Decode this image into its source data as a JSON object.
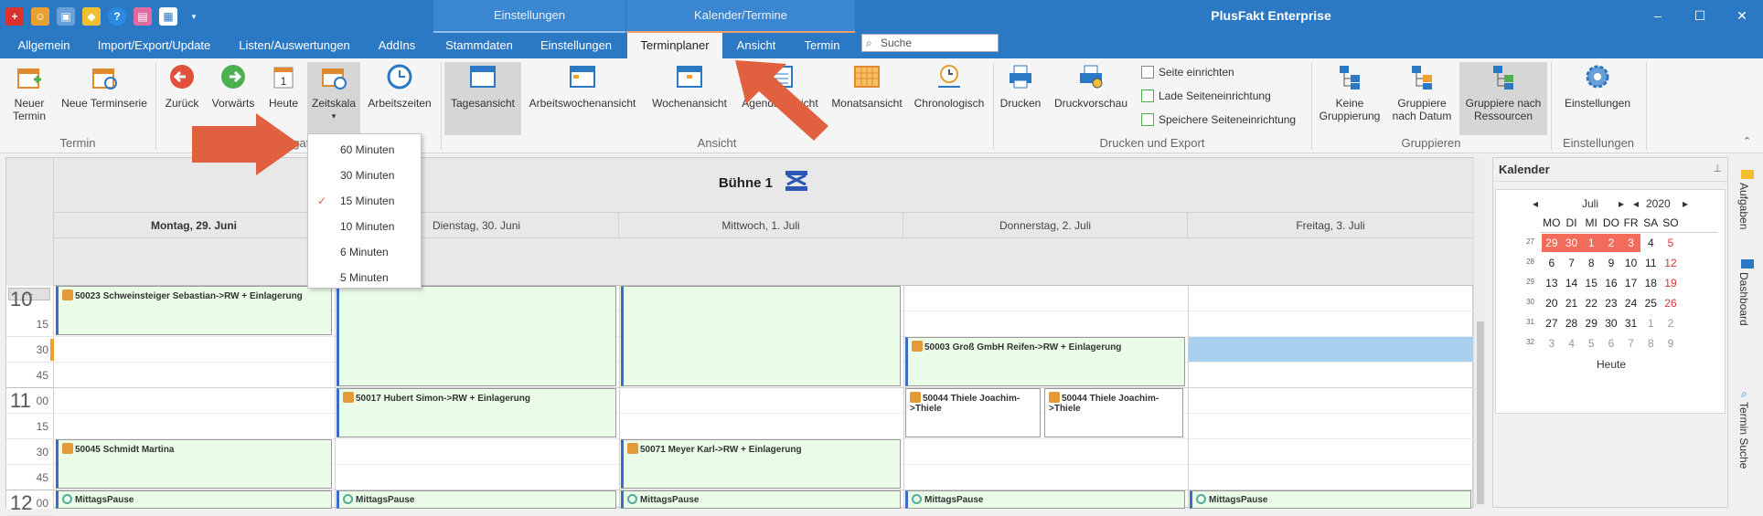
{
  "title_bar": {
    "context_tab_einstellungen": "Einstellungen",
    "context_tab_kalender": "Kalender/Termine",
    "app_title": "PlusFakt Enterprise",
    "minimize": "–",
    "maximize": "☐",
    "close": "✕"
  },
  "tabs": {
    "allgemein": "Allgemein",
    "import_export": "Import/Export/Update",
    "listen": "Listen/Auswertungen",
    "addins": "AddIns",
    "stammdaten": "Stammdaten",
    "einstellungen": "Einstellungen",
    "terminplaner": "Terminplaner",
    "ansicht": "Ansicht",
    "termin": "Termin"
  },
  "search": {
    "placeholder": "Suche"
  },
  "ribbon": {
    "neuer_termin": "Neuer Termin",
    "neue_terminserie": "Neue Terminserie",
    "zurueck": "Zurück",
    "vorwaerts": "Vorwärts",
    "heute": "Heute",
    "zeitskala": "Zeitskala",
    "arbeitszeiten": "Arbeitszeiten",
    "tagesansicht": "Tagesansicht",
    "arbeitswochenansicht": "Arbeitswochenansicht",
    "wochenansicht": "Wochenansicht",
    "agenda_ansicht": "Agenda Ansicht",
    "monatsansicht": "Monatsansicht",
    "chronologisch": "Chronologisch",
    "drucken": "Drucken",
    "druckvorschau": "Druckvorschau",
    "seite_einrichten": "Seite einrichten",
    "lade_seiteneinrichtung": "Lade Seiteneinrichtung",
    "speichere_seiteneinrichtung": "Speichere Seiteneinrichtung",
    "keine_gruppierung": "Keine Gruppierung",
    "gruppiere_datum": "Gruppiere nach Datum",
    "gruppiere_ressourcen": "Gruppiere nach Ressourcen",
    "einstellungen": "Einstellungen",
    "group_termin": "Termin",
    "group_navigation": "Navigation",
    "group_ansicht": "Ansicht",
    "group_drucken": "Drucken und Export",
    "group_gruppieren": "Gruppieren",
    "group_einstellungen": "Einstellungen",
    "heute_day": "1"
  },
  "zeitskala_menu": {
    "items": [
      "60 Minuten",
      "30 Minuten",
      "15 Minuten",
      "10 Minuten",
      "6 Minuten",
      "5 Minuten"
    ],
    "checked": "15 Minuten"
  },
  "calendar": {
    "resource": "Bühne 1",
    "days": [
      "Montag, 29. Juni",
      "Dienstag, 30. Juni",
      "Mittwoch, 1. Juli",
      "Donnerstag, 2. Juli",
      "Freitag, 3. Juli"
    ],
    "more": "···",
    "hour_10": "10",
    "hour_11": "11",
    "hour_12": "12",
    "slot_15": "15",
    "slot_30": "30",
    "slot_45": "45",
    "slot_00": "00",
    "appointments": {
      "a1": "50023 Schweinsteiger Sebastian->RW + Einlagerung",
      "a2": "50003 Groß GmbH Reifen->RW + Einlagerung",
      "a3": "50017 Hubert Simon->RW + Einlagerung",
      "a4": "50044 Thiele Joachim->Thiele",
      "a5": "50044 Thiele Joachim->Thiele",
      "a6": "50045 Schmidt Martina",
      "a7": "50071 Meyer Karl->RW + Einlagerung",
      "pause": "MittagsPause"
    }
  },
  "kalender_panel": {
    "title": "Kalender",
    "month": "Juli",
    "year": "2020",
    "weekdays": [
      "MO",
      "DI",
      "MI",
      "DO",
      "FR",
      "SA",
      "SO"
    ],
    "weeks": [
      {
        "wk": "27",
        "days": [
          "29",
          "30",
          "1",
          "2",
          "3",
          "4",
          "5"
        ]
      },
      {
        "wk": "28",
        "days": [
          "6",
          "7",
          "8",
          "9",
          "10",
          "11",
          "12"
        ]
      },
      {
        "wk": "29",
        "days": [
          "13",
          "14",
          "15",
          "16",
          "17",
          "18",
          "19"
        ]
      },
      {
        "wk": "30",
        "days": [
          "20",
          "21",
          "22",
          "23",
          "24",
          "25",
          "26"
        ]
      },
      {
        "wk": "31",
        "days": [
          "27",
          "28",
          "29",
          "30",
          "31",
          "1",
          "2"
        ]
      },
      {
        "wk": "32",
        "days": [
          "3",
          "4",
          "5",
          "6",
          "7",
          "8",
          "9"
        ]
      }
    ],
    "heute": "Heute"
  },
  "side_tabs": {
    "aufgaben": "Aufgaben",
    "dashboard": "Dashboard",
    "termin_suche": "Termin Suche"
  },
  "colors": {
    "title_blue": "#2b78c5",
    "accent_orange": "#e0604a",
    "appt_green": "#eafbe8",
    "selected_red": "#f36b5b"
  }
}
